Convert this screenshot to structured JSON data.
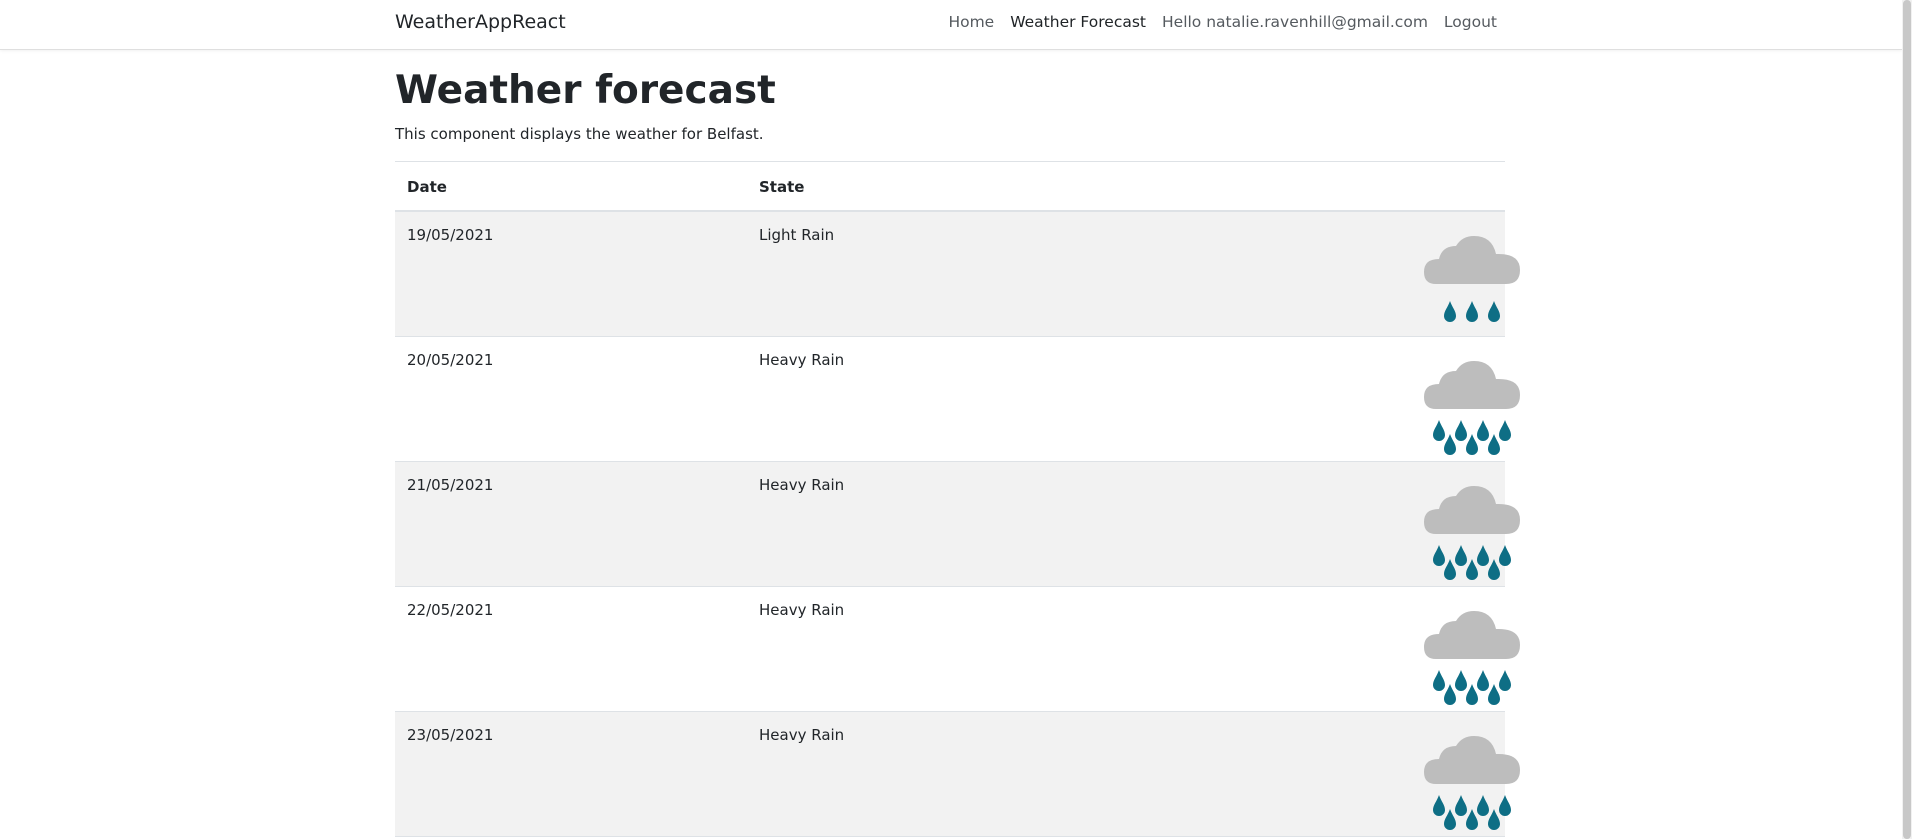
{
  "navbar": {
    "brand": "WeatherAppReact",
    "links": [
      {
        "label": "Home",
        "active": false
      },
      {
        "label": "Weather Forecast",
        "active": true
      },
      {
        "label": "Hello natalie.ravenhill@gmail.com",
        "active": false
      },
      {
        "label": "Logout",
        "active": false
      }
    ]
  },
  "page": {
    "title": "Weather forecast",
    "description": "This component displays the weather for Belfast."
  },
  "table": {
    "headers": [
      "Date",
      "State",
      ""
    ],
    "rows": [
      {
        "date": "19/05/2021",
        "state": "Light Rain",
        "icon": "light-rain-icon"
      },
      {
        "date": "20/05/2021",
        "state": "Heavy Rain",
        "icon": "heavy-rain-icon"
      },
      {
        "date": "21/05/2021",
        "state": "Heavy Rain",
        "icon": "heavy-rain-icon"
      },
      {
        "date": "22/05/2021",
        "state": "Heavy Rain",
        "icon": "heavy-rain-icon"
      },
      {
        "date": "23/05/2021",
        "state": "Heavy Rain",
        "icon": "heavy-rain-icon"
      }
    ]
  },
  "colors": {
    "cloud": "#bdbdbd",
    "raindrop": "#0e6e85",
    "stripe": "#f2f2f2",
    "border": "#dee2e6"
  }
}
